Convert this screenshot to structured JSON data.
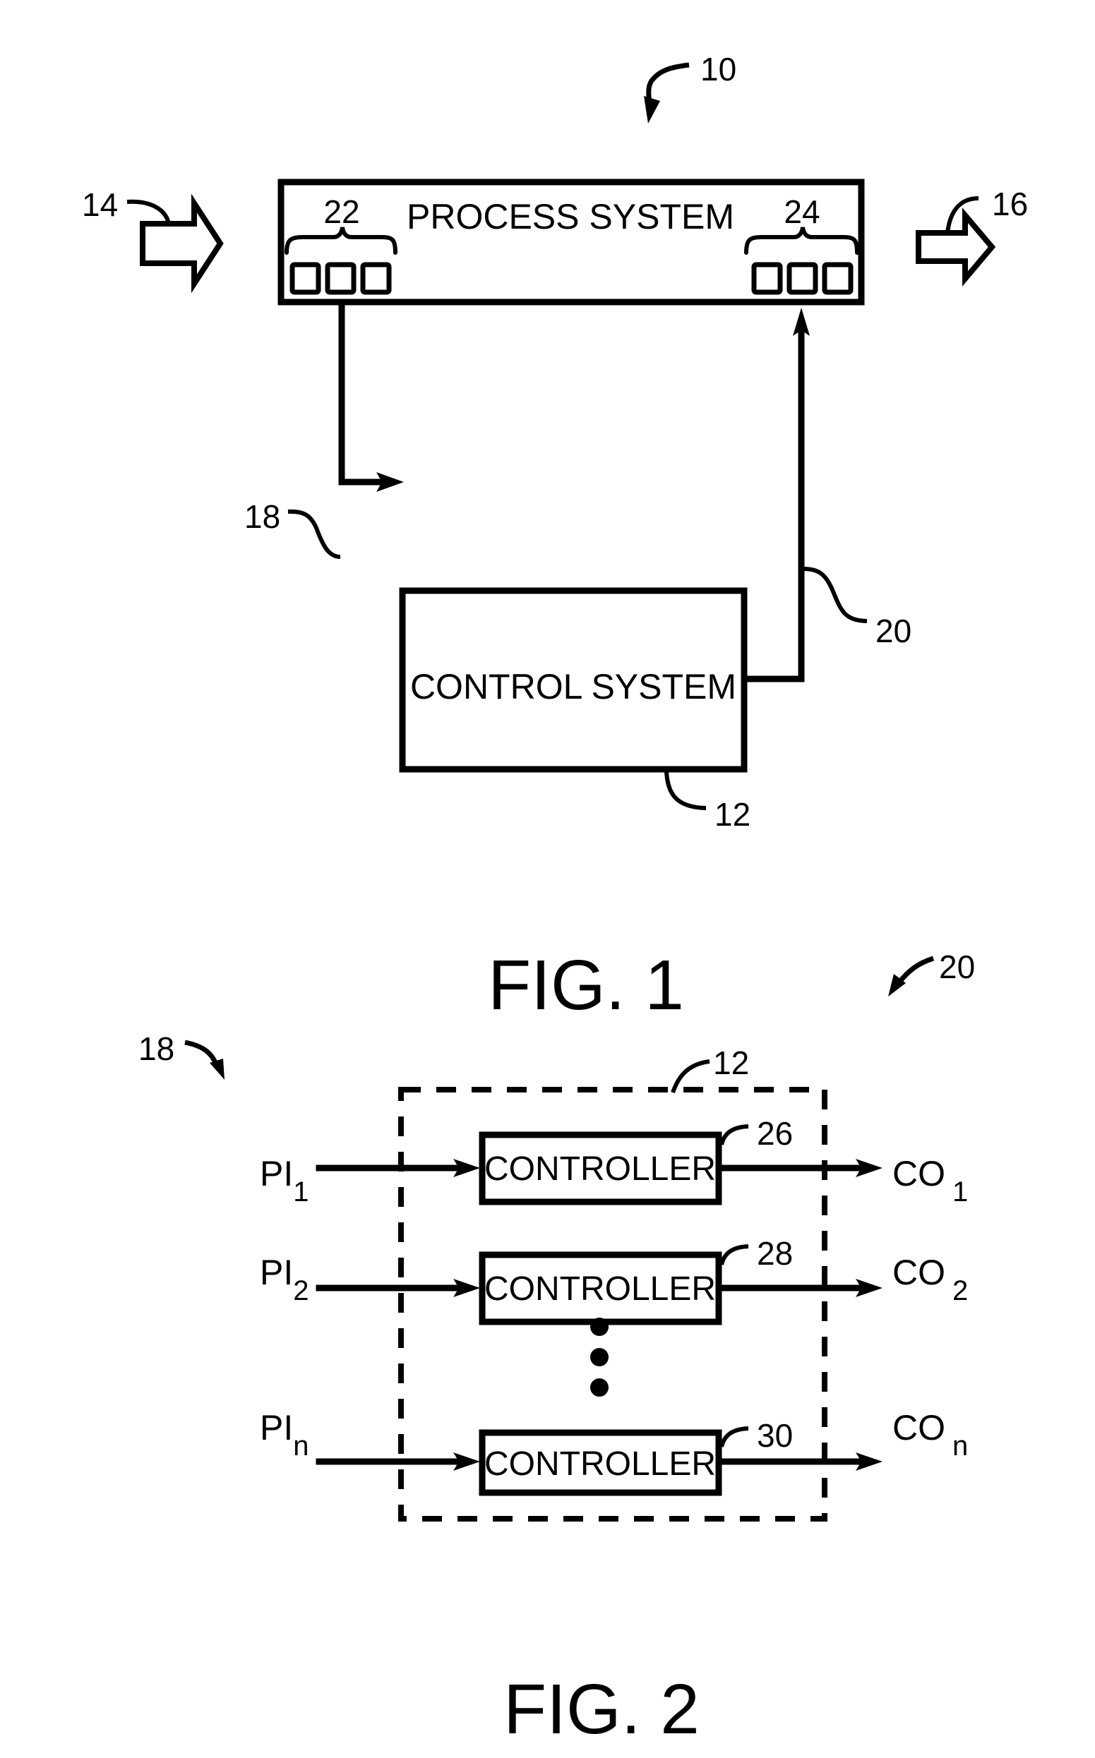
{
  "fig1": {
    "caption": "FIG. 1",
    "ref_system": "10",
    "process_box": {
      "label": "PROCESS SYSTEM",
      "ref_sensors": "22",
      "ref_actuators": "24"
    },
    "control_box": {
      "label": "CONTROL SYSTEM",
      "ref": "12"
    },
    "input_arrow_ref": "14",
    "output_arrow_ref": "16",
    "signal_in_ref": "18",
    "signal_out_ref": "20"
  },
  "fig2": {
    "caption": "FIG. 2",
    "ref_inputs": "18",
    "ref_outputs": "20",
    "ref_control_system": "12",
    "ellipsis": "⋮",
    "rows": [
      {
        "input": "PI",
        "input_sub": "1",
        "controller_label": "CONTROLLER",
        "ref": "26",
        "output": "CO",
        "output_sub": "1"
      },
      {
        "input": "PI",
        "input_sub": "2",
        "controller_label": "CONTROLLER",
        "ref": "28",
        "output": "CO",
        "output_sub": "2"
      },
      {
        "input": "PI",
        "input_sub": "n",
        "controller_label": "CONTROLLER",
        "ref": "30",
        "output": "CO",
        "output_sub": "n"
      }
    ]
  }
}
